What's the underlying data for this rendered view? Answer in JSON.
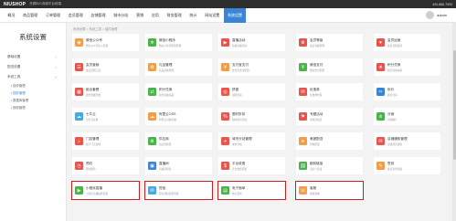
{
  "topbar": {
    "logo": "NIUSHOP",
    "slogan": "开源B2C商城平台前端",
    "hotline": "400-886-7993"
  },
  "nav": {
    "items": [
      "概况",
      "商品管理",
      "订单管理",
      "会员管理",
      "店铺管理",
      "城市分站",
      "营销",
      "应用",
      "财务管理",
      "统计",
      "网站设置",
      "系统设置"
    ],
    "active_index": 11,
    "user": "admin"
  },
  "sidebar": {
    "title": "系统设置",
    "groups": [
      {
        "label": "基础设置",
        "chevron": "›"
      },
      {
        "label": "配送设置",
        "chevron": "›"
      },
      {
        "label": "系统工具",
        "chevron": "˅"
      }
    ],
    "subs": [
      "• 操作管理",
      "• 插件管理",
      "• 数据库管理",
      "• 授权管理"
    ],
    "active_sub": 1
  },
  "breadcrumb": "系统设置 > 系统工具 > 插件管理",
  "cards": [
    {
      "name": "微信公众号",
      "desc": "微信公众号接入配置",
      "color": "#f39c4a",
      "icon": "wechat-icon",
      "glyph": "◉"
    },
    {
      "name": "微信小程序",
      "desc": "微信小程序配置管理",
      "color": "#4ab34a",
      "icon": "miniapp-icon",
      "glyph": "✲"
    },
    {
      "name": "直播活动",
      "desc": "商城直播活动",
      "color": "#e8554e",
      "icon": "live-icon",
      "glyph": "▶"
    },
    {
      "name": "会员等级",
      "desc": "会员等级管理",
      "color": "#e8554e",
      "icon": "member-level-icon",
      "glyph": "♛"
    },
    {
      "name": "会员运营",
      "desc": "会员营销运营",
      "color": "#e8554e",
      "icon": "member-ops-icon",
      "glyph": "♥"
    },
    {
      "name": "会员营销",
      "desc": "会员营销工具",
      "color": "#e8554e",
      "icon": "marketing-icon",
      "glyph": "☰"
    },
    {
      "name": "礼品管理",
      "desc": "礼品兑换管理",
      "color": "#f39c4a",
      "icon": "gift-icon",
      "glyph": "✿"
    },
    {
      "name": "支付宝支付",
      "desc": "支付宝支付配置",
      "color": "#f39c4a",
      "icon": "alipay-icon",
      "glyph": "¥"
    },
    {
      "name": "微信支付",
      "desc": "微信支付配置",
      "color": "#4ab34a",
      "icon": "wxpay-icon",
      "glyph": "¥"
    },
    {
      "name": "积分兑换",
      "desc": "积分商城兑换",
      "color": "#e8554e",
      "icon": "points-icon",
      "glyph": "★"
    },
    {
      "name": "组合套餐",
      "desc": "组合套餐优惠",
      "color": "#e8554e",
      "icon": "combo-icon",
      "glyph": "▦"
    },
    {
      "name": "积分兑换",
      "desc": "积分兑换商品",
      "color": "#4ab34a",
      "icon": "exchange-icon",
      "glyph": "⇄"
    },
    {
      "name": "拼团",
      "desc": "拼团活动",
      "color": "#e8554e",
      "icon": "group-icon",
      "glyph": "◎"
    },
    {
      "name": "优惠券",
      "desc": "优惠券管理",
      "color": "#e8554e",
      "icon": "coupon-icon",
      "glyph": "✉"
    },
    {
      "name": "砍价",
      "desc": "砍价活动",
      "color": "#3a85d6",
      "icon": "bargain-icon",
      "glyph": "✂"
    },
    {
      "name": "七牛云",
      "desc": "七牛云存储",
      "color": "#4aa8e0",
      "icon": "qiniu-icon",
      "glyph": "☁"
    },
    {
      "name": "阿里云OSS",
      "desc": "阿里云对象存储",
      "color": "#f39c4a",
      "icon": "oss-icon",
      "glyph": "☁"
    },
    {
      "name": "限时折扣",
      "desc": "限时折扣活动",
      "color": "#e8554e",
      "icon": "discount-icon",
      "glyph": "%"
    },
    {
      "name": "专题活动",
      "desc": "专题活动页",
      "color": "#e8554e",
      "icon": "topic-icon",
      "glyph": "⚑"
    },
    {
      "name": "分销",
      "desc": "分销推广",
      "color": "#4ab34a",
      "icon": "fenxiao-icon",
      "glyph": "⋔"
    },
    {
      "name": "门店管理",
      "desc": "线下门店管理",
      "color": "#e8554e",
      "icon": "store-icon",
      "glyph": "⌂"
    },
    {
      "name": "供应商",
      "desc": "供应商管理",
      "color": "#4ab34a",
      "icon": "supplier-icon",
      "glyph": "⚙"
    },
    {
      "name": "城市分站管理",
      "desc": "城市分站",
      "color": "#e8554e",
      "icon": "city-icon",
      "glyph": "⌖"
    },
    {
      "name": "美团配送",
      "desc": "同城配送",
      "color": "#f39c4a",
      "icon": "delivery-icon",
      "glyph": "➤"
    },
    {
      "name": "店铺通知管理",
      "desc": "店铺消息通知",
      "color": "#e8554e",
      "icon": "notify-icon",
      "glyph": "✉"
    },
    {
      "name": "预约",
      "desc": "预约服务",
      "color": "#e8554e",
      "icon": "booking-icon",
      "glyph": "◷"
    },
    {
      "name": "直播间",
      "desc": "直播间管理",
      "color": "#3a85d6",
      "icon": "liveroom-icon",
      "glyph": "▣"
    },
    {
      "name": "平台收费",
      "desc": "平台收费配置",
      "color": "#e8554e",
      "icon": "fee-icon",
      "glyph": "$"
    },
    {
      "name": "跳转链接",
      "desc": "自定义链接",
      "color": "#4ab34a",
      "icon": "link-icon",
      "glyph": "⛓"
    },
    {
      "name": "签到",
      "desc": "会员签到奖励",
      "color": "#f39c4a",
      "icon": "signin-icon",
      "glyph": "✎"
    },
    {
      "name": "小程序直播",
      "desc": "小程序直播插件配置",
      "color": "#4ab34a",
      "icon": "mini-live-icon",
      "glyph": "▶",
      "hl": true
    },
    {
      "name": "短信",
      "desc": "短信通知配置管理",
      "color": "#4aa8e0",
      "icon": "sms-icon",
      "glyph": "✉",
      "hl": true
    },
    {
      "name": "电子面单",
      "desc": "电子面单",
      "color": "#4ab34a",
      "icon": "waybill-icon",
      "glyph": "▤",
      "hl": true
    },
    {
      "name": "客服",
      "desc": "客服系统",
      "color": "#f39c4a",
      "icon": "service-icon",
      "glyph": "☏",
      "hl": true
    }
  ]
}
